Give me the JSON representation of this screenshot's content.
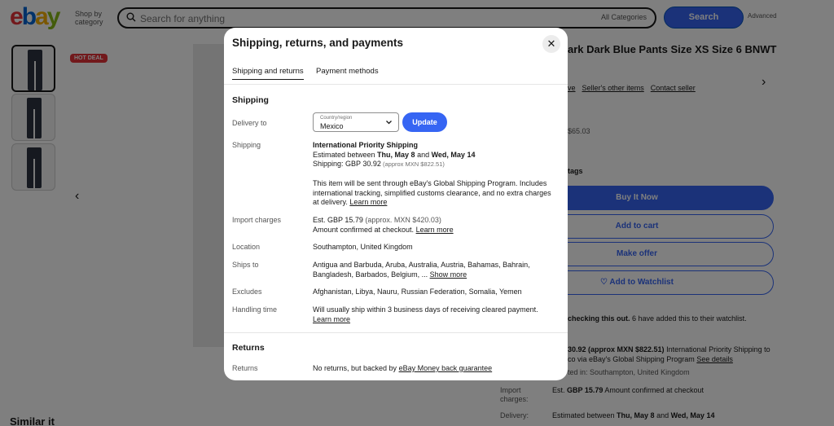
{
  "header": {
    "logo_e": "e",
    "logo_b": "b",
    "logo_a": "a",
    "logo_y": "y",
    "shop_by_category": "Shop by category",
    "search_placeholder": "Search for anything",
    "all_categories": "All Categories",
    "search_button": "Search",
    "advanced": "Advanced"
  },
  "gallery": {
    "badge": "HOT DEAL"
  },
  "product": {
    "title": "ark Dark Blue Pants Size XS Size 6 BNWT",
    "seller_other_items": "Seller's other items",
    "contact_seller": "Contact seller",
    "ve": "ve",
    "price_hint": "$65.03",
    "tags": "tags",
    "buy_it_now": "Buy It Now",
    "add_to_cart": "Add to cart",
    "make_offer": "Make offer",
    "add_to_watchlist": "Add to Watchlist",
    "watch_bold": "checking this out.",
    "watch_rest": " 6 have added this to their watchlist.",
    "ship_line1_bold": "30.92 (approx MXN $822.51)",
    "ship_line1_rest": " International Priority Shipping to",
    "ship_line2": "co via eBay's Global Shipping Program",
    "see_details": "See details",
    "located_in": "ted in: Southampton, United Kingdom",
    "import_label": "Import charges:",
    "import_value_pre": "Est.",
    "import_value_bold": "GBP 15.79",
    "import_value_rest": " Amount confirmed at checkout",
    "delivery_label": "Delivery:",
    "delivery_value_pre": "Estimated between ",
    "delivery_value_b1": "Thu, May 8",
    "delivery_value_mid": " and ",
    "delivery_value_b2": "Wed, May 14",
    "similar": "Similar it"
  },
  "modal": {
    "title": "Shipping, returns, and payments",
    "tabs": {
      "shipping": "Shipping and returns",
      "payment": "Payment methods"
    },
    "shipping": {
      "heading": "Shipping",
      "delivery_to_label": "Delivery to",
      "country_small": "Country/region",
      "country_value": "Mexico",
      "update": "Update",
      "shipping_label": "Shipping",
      "service": "International Priority Shipping",
      "est_pre": "Estimated between ",
      "est_d1": "Thu, May 8",
      "est_mid": " and ",
      "est_d2": "Wed, May 14",
      "cost_pre": "Shipping: GBP 30.92",
      "cost_approx": " (approx MXN $822.51)",
      "gsp_text": "This item will be sent through eBay's Global Shipping Program. Includes international tracking, simplified customs clearance, and no extra charges at delivery. ",
      "learn_more": "Learn more",
      "import_label": "Import charges",
      "import_est": "Est. GBP 15.79",
      "import_approx": " (approx. MXN $420.03)",
      "import_confirm": "Amount confirmed at checkout. ",
      "location_label": "Location",
      "location_value": "Southampton, United Kingdom",
      "ships_to_label": "Ships to",
      "ships_to_value": "Antigua and Barbuda, Aruba, Australia, Austria, Bahamas, Bahrain, Bangladesh, Barbados, Belgium, ... ",
      "show_more": "Show more",
      "excludes_label": "Excludes",
      "excludes_value": "Afghanistan, Libya, Nauru, Russian Federation, Somalia, Yemen",
      "handling_label": "Handling time",
      "handling_value": "Will usually ship within 3 business days of receiving cleared payment. "
    },
    "returns": {
      "heading": "Returns",
      "label": "Returns",
      "value_pre": "No returns, but backed by ",
      "value_link": "eBay Money back guarantee"
    }
  }
}
